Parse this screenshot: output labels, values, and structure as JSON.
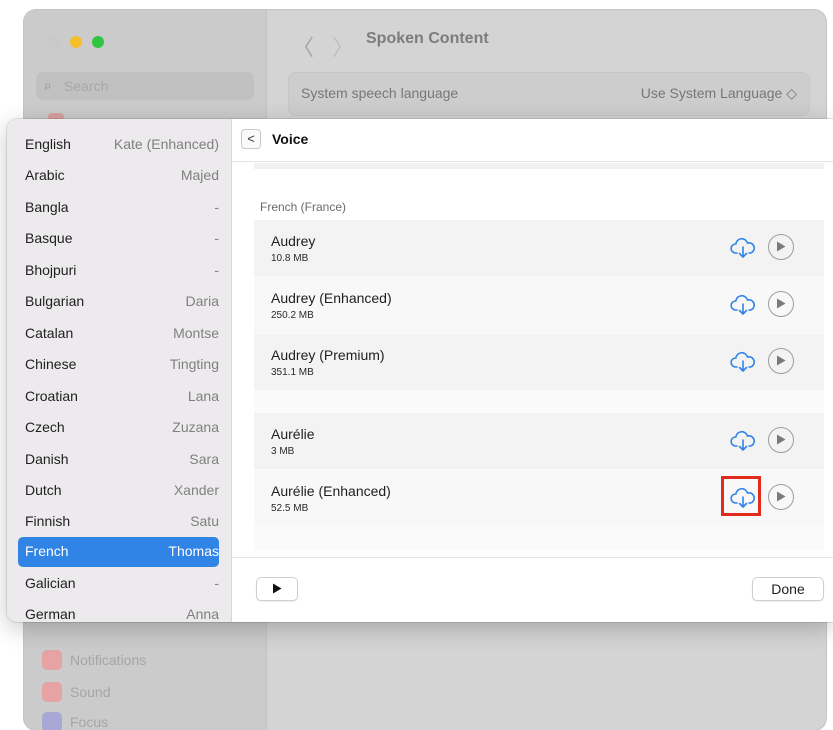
{
  "background_window": {
    "search_placeholder": "Search",
    "title": "Spoken Content",
    "nav_back": "〈",
    "nav_forward": "〉",
    "setting_label": "System speech language",
    "setting_value": "Use System Language ◇",
    "sidebar_items": [
      {
        "label": "Notifications",
        "icon": "bell-icon",
        "color": "#e6a3a3"
      },
      {
        "label": "Sound",
        "icon": "speaker-icon",
        "color": "#e6a3a3"
      },
      {
        "label": "Focus",
        "icon": "moon-icon",
        "color": "#a9a7d6"
      }
    ]
  },
  "languages": [
    {
      "name": "English",
      "voice": "Kate (Enhanced)"
    },
    {
      "name": "Arabic",
      "voice": "Majed"
    },
    {
      "name": "Bangla",
      "voice": "-"
    },
    {
      "name": "Basque",
      "voice": "-"
    },
    {
      "name": "Bhojpuri",
      "voice": "-"
    },
    {
      "name": "Bulgarian",
      "voice": "Daria"
    },
    {
      "name": "Catalan",
      "voice": "Montse"
    },
    {
      "name": "Chinese",
      "voice": "Tingting"
    },
    {
      "name": "Croatian",
      "voice": "Lana"
    },
    {
      "name": "Czech",
      "voice": "Zuzana"
    },
    {
      "name": "Danish",
      "voice": "Sara"
    },
    {
      "name": "Dutch",
      "voice": "Xander"
    },
    {
      "name": "Finnish",
      "voice": "Satu"
    },
    {
      "name": "French",
      "voice": "Thomas",
      "selected": true
    },
    {
      "name": "Galician",
      "voice": "-"
    },
    {
      "name": "German",
      "voice": "Anna"
    }
  ],
  "voice_pane": {
    "title": "Voice",
    "back_glyph": "<",
    "section_label": "French (France)",
    "voices": [
      {
        "name": "Audrey",
        "size": "10.8 MB"
      },
      {
        "name": "Audrey (Enhanced)",
        "size": "250.2 MB"
      },
      {
        "name": "Audrey (Premium)",
        "size": "351.1 MB"
      },
      {
        "name": "Aurélie",
        "size": "3 MB"
      },
      {
        "name": "Aurélie (Enhanced)",
        "size": "52.5 MB",
        "highlighted": true
      }
    ],
    "done_label": "Done"
  },
  "colors": {
    "accent": "#2f84e6",
    "cloud_icon": "#2f84e6",
    "highlight_box": "#e22b1c"
  }
}
